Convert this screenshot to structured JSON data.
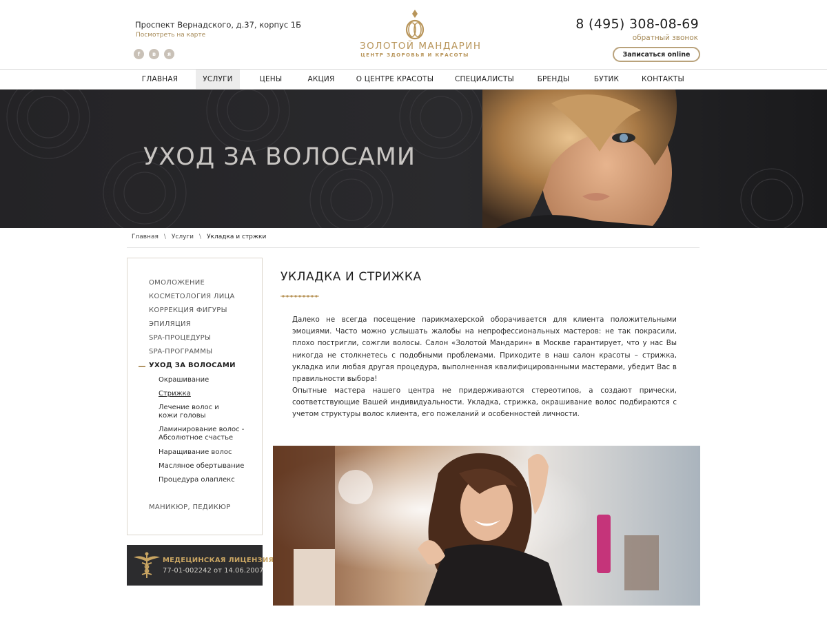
{
  "header": {
    "address": "Проспект Вернадского, д.37, корпус 1Б",
    "map_link": "Посмотреть на карте",
    "socials": [
      "f",
      "в",
      "я"
    ],
    "logo_name": "ЗОЛОТОЙ МАНДАРИН",
    "logo_sub": "ЦЕНТР ЗДОРОВЬЯ И КРАСОТЫ",
    "phone": "8 (495) 308-08-69",
    "callback": "обратный звонок",
    "signup": "Записаться online"
  },
  "nav": {
    "items": [
      "ГЛАВНАЯ",
      "УСЛУГИ",
      "ЦЕНЫ",
      "АКЦИЯ",
      "О ЦЕНТРЕ КРАСОТЫ",
      "СПЕЦИАЛИСТЫ",
      "БРЕНДЫ",
      "БУТИК",
      "КОНТАКТЫ"
    ],
    "active": "УСЛУГИ"
  },
  "hero": {
    "title": "УХОД ЗА ВОЛОСАМИ"
  },
  "breadcrumbs": {
    "items": [
      "Главная",
      "Услуги",
      "Укладка и стржки"
    ]
  },
  "sidebar": {
    "items": [
      "ОМОЛОЖЕНИЕ",
      "КОСМЕТОЛОГИЯ ЛИЦА",
      "КОРРЕКЦИЯ ФИГУРЫ",
      "ЭПИЛЯЦИЯ",
      "SPA-ПРОЦЕДУРЫ",
      "SPA-ПРОГРАММЫ",
      "УХОД ЗА ВОЛОСАМИ"
    ],
    "active": "УХОД ЗА ВОЛОСАМИ",
    "subitems": [
      "Окрашивание",
      "Стрижка",
      "Лечение волос и",
      "кожи головы",
      "Ламинирование волос -",
      "Абсолютное счастье",
      "Наращивание волос",
      "Масляное обертывание",
      "Процедура олаплекс"
    ],
    "current_subitem": "Стрижка",
    "bottom_item": "МАНИКЮР, ПЕДИКЮР"
  },
  "license": {
    "title": "МЕДЕЦИНСКАЯ ЛИЦЕНЗИЯ",
    "number": "77-01-002242  от 14.06.2007"
  },
  "main": {
    "title": "УКЛАДКА И СТРИЖКА",
    "paragraph1": "Далеко не всегда посещение парикмахерской оборачивается для клиента положительными эмоциями. Часто можно услышать жалобы на непрофессиональных мастеров: не так покрасили, плохо постригли, сожгли волосы. Салон «Золотой Мандарин» в Москве гарантирует, что у нас Вы никогда не столкнетесь с подобными проблемами. Приходите в наш салон красоты – стрижка, укладка или любая другая процедура, выполненная квалифицированными мастерами, убедит Вас в правильности выбора!",
    "paragraph2": "Опытные мастера нашего центра не придерживаются стереотипов, а создают прически, соответствующие Вашей индивидуальности. Укладка, стрижка, окрашивание волос подбираются с учетом структуры волос клиента, его пожеланий и особенностей личности."
  },
  "colors": {
    "gold": "#b8955a",
    "dark": "#242326",
    "nav_active_bg": "#ececec"
  }
}
